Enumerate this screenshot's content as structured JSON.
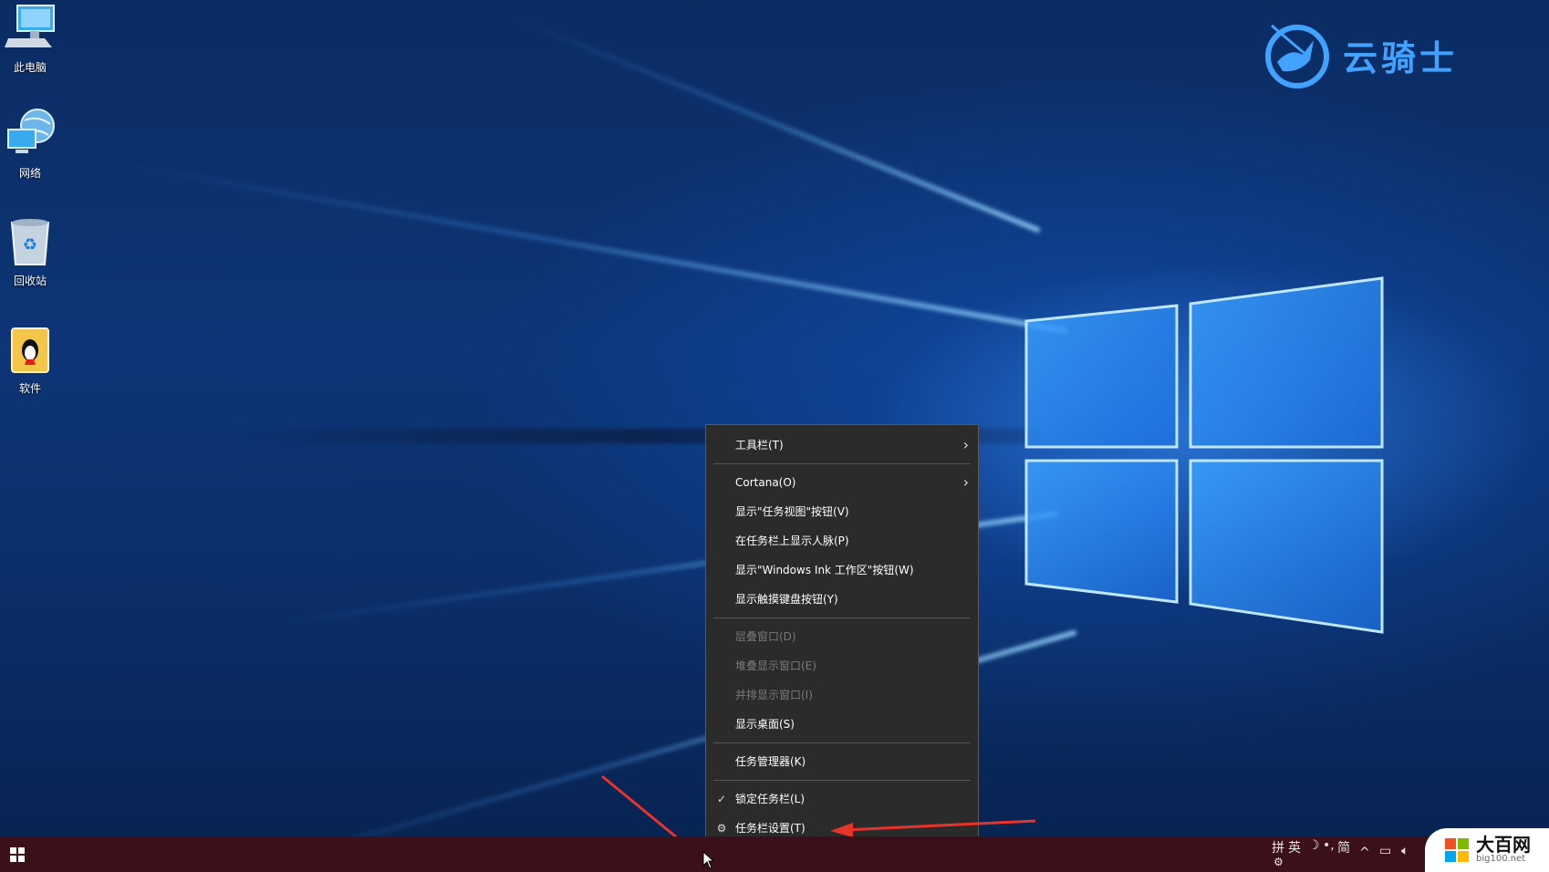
{
  "desktop_icons": [
    {
      "label": "此电脑",
      "icon": "computer-icon"
    },
    {
      "label": "网络",
      "icon": "network-icon"
    },
    {
      "label": "回收站",
      "icon": "recycle-bin-icon"
    },
    {
      "label": "软件",
      "icon": "folder-icon"
    }
  ],
  "brand": {
    "text": "云骑士",
    "icon": "knight-logo-icon",
    "color": "#41a2ff"
  },
  "context_menu": {
    "items": [
      {
        "label": "工具栏(T)",
        "submenu": true
      },
      {
        "label": "Cortana(O)",
        "submenu": true
      },
      {
        "label": "显示\"任务视图\"按钮(V)"
      },
      {
        "label": "在任务栏上显示人脉(P)"
      },
      {
        "label": "显示\"Windows Ink 工作区\"按钮(W)"
      },
      {
        "label": "显示触摸键盘按钮(Y)"
      },
      {
        "label": "层叠窗口(D)",
        "disabled": true
      },
      {
        "label": "堆叠显示窗口(E)",
        "disabled": true
      },
      {
        "label": "并排显示窗口(I)",
        "disabled": true
      },
      {
        "label": "显示桌面(S)"
      },
      {
        "label": "任务管理器(K)"
      },
      {
        "label": "锁定任务栏(L)",
        "checked": true
      },
      {
        "label": "任务栏设置(T)",
        "icon": "gear-icon"
      }
    ]
  },
  "taskbar": {
    "color": "#3b1019",
    "tray": {
      "ime_mode": "拼",
      "language": "英",
      "width_mode": "简"
    }
  },
  "watermark": {
    "title": "大百网",
    "url": "big100.net"
  },
  "annotation_color": "#e8332b"
}
